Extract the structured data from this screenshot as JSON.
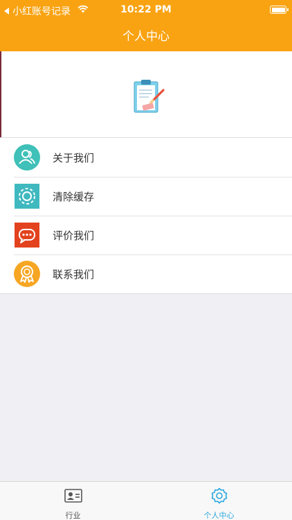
{
  "status_bar": {
    "back_app": "小红账号记录",
    "time": "10:22 PM"
  },
  "nav": {
    "title": "个人中心"
  },
  "colors": {
    "brand_orange": "#f9a312",
    "active_tab": "#2aa6de"
  },
  "menu": {
    "items": [
      {
        "label": "关于我们",
        "icon": "users-icon"
      },
      {
        "label": "清除缓存",
        "icon": "gear-icon"
      },
      {
        "label": "评价我们",
        "icon": "chat-icon"
      },
      {
        "label": "联系我们",
        "icon": "award-icon"
      }
    ]
  },
  "tabbar": {
    "tabs": [
      {
        "label": "行业",
        "icon": "id-card-icon",
        "active": false
      },
      {
        "label": "个人中心",
        "icon": "gear-icon",
        "active": true
      }
    ]
  }
}
